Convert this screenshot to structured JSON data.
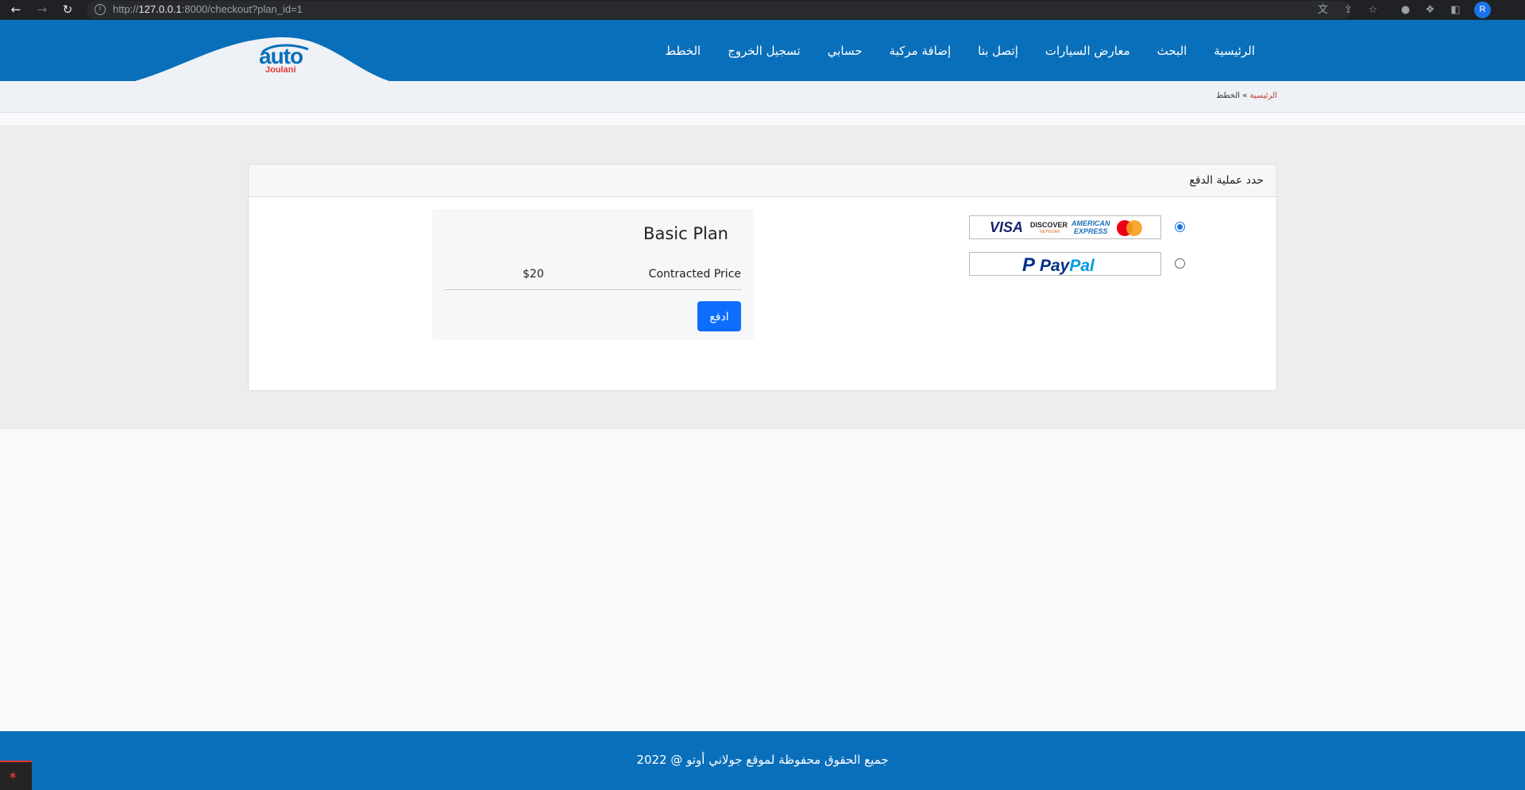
{
  "browser": {
    "url_prefix": "http://",
    "url_host": "127.0.0.1",
    "url_rest": ":8000/checkout?plan_id=1",
    "profile_initial": "R",
    "icons": {
      "back": "back-arrow-icon",
      "forward": "forward-arrow-icon",
      "reload": "reload-icon",
      "info": "site-info-icon",
      "translate": "translate-icon",
      "share": "share-icon",
      "bookmark": "star-icon",
      "extensions": "puzzle-icon",
      "sidepanel": "side-panel-icon"
    }
  },
  "header": {
    "logo_auto": "auto",
    "logo_joulani": "Joulani",
    "nav": [
      {
        "label": "الرئيسية"
      },
      {
        "label": "البحث"
      },
      {
        "label": "معارض السيارات"
      },
      {
        "label": "إتصل بنا"
      },
      {
        "label": "إضافة مركبة"
      },
      {
        "label": "حسابي"
      },
      {
        "label": "تسجيل الخروج"
      },
      {
        "label": "الخطط"
      }
    ]
  },
  "breadcrumb": {
    "home": "الرئيسية",
    "separator": "»",
    "current": "الخطط"
  },
  "checkout": {
    "card_title": "حدد عملية الدفع",
    "methods": [
      {
        "id": "card",
        "selected": true,
        "brands": {
          "visa": "VISA",
          "discover": "DISCOVER",
          "discover_sub": "NETWORK",
          "amex_line1": "AMERICAN",
          "amex_line2": "EXPRESS"
        }
      },
      {
        "id": "paypal",
        "selected": false,
        "pay": "Pay",
        "pal": "Pal"
      }
    ],
    "plan": {
      "name": "Basic Plan",
      "price_label": "Contracted Price",
      "price": "$20",
      "pay_button": "ادفع"
    }
  },
  "footer": {
    "text": "جميع الحقوق محفوظة لموقع جولاني أوتو @ 2022"
  },
  "colors": {
    "brand_blue": "#0a6fba",
    "button_blue": "#0d6efd",
    "breadcrumb_link": "#c0392b"
  }
}
